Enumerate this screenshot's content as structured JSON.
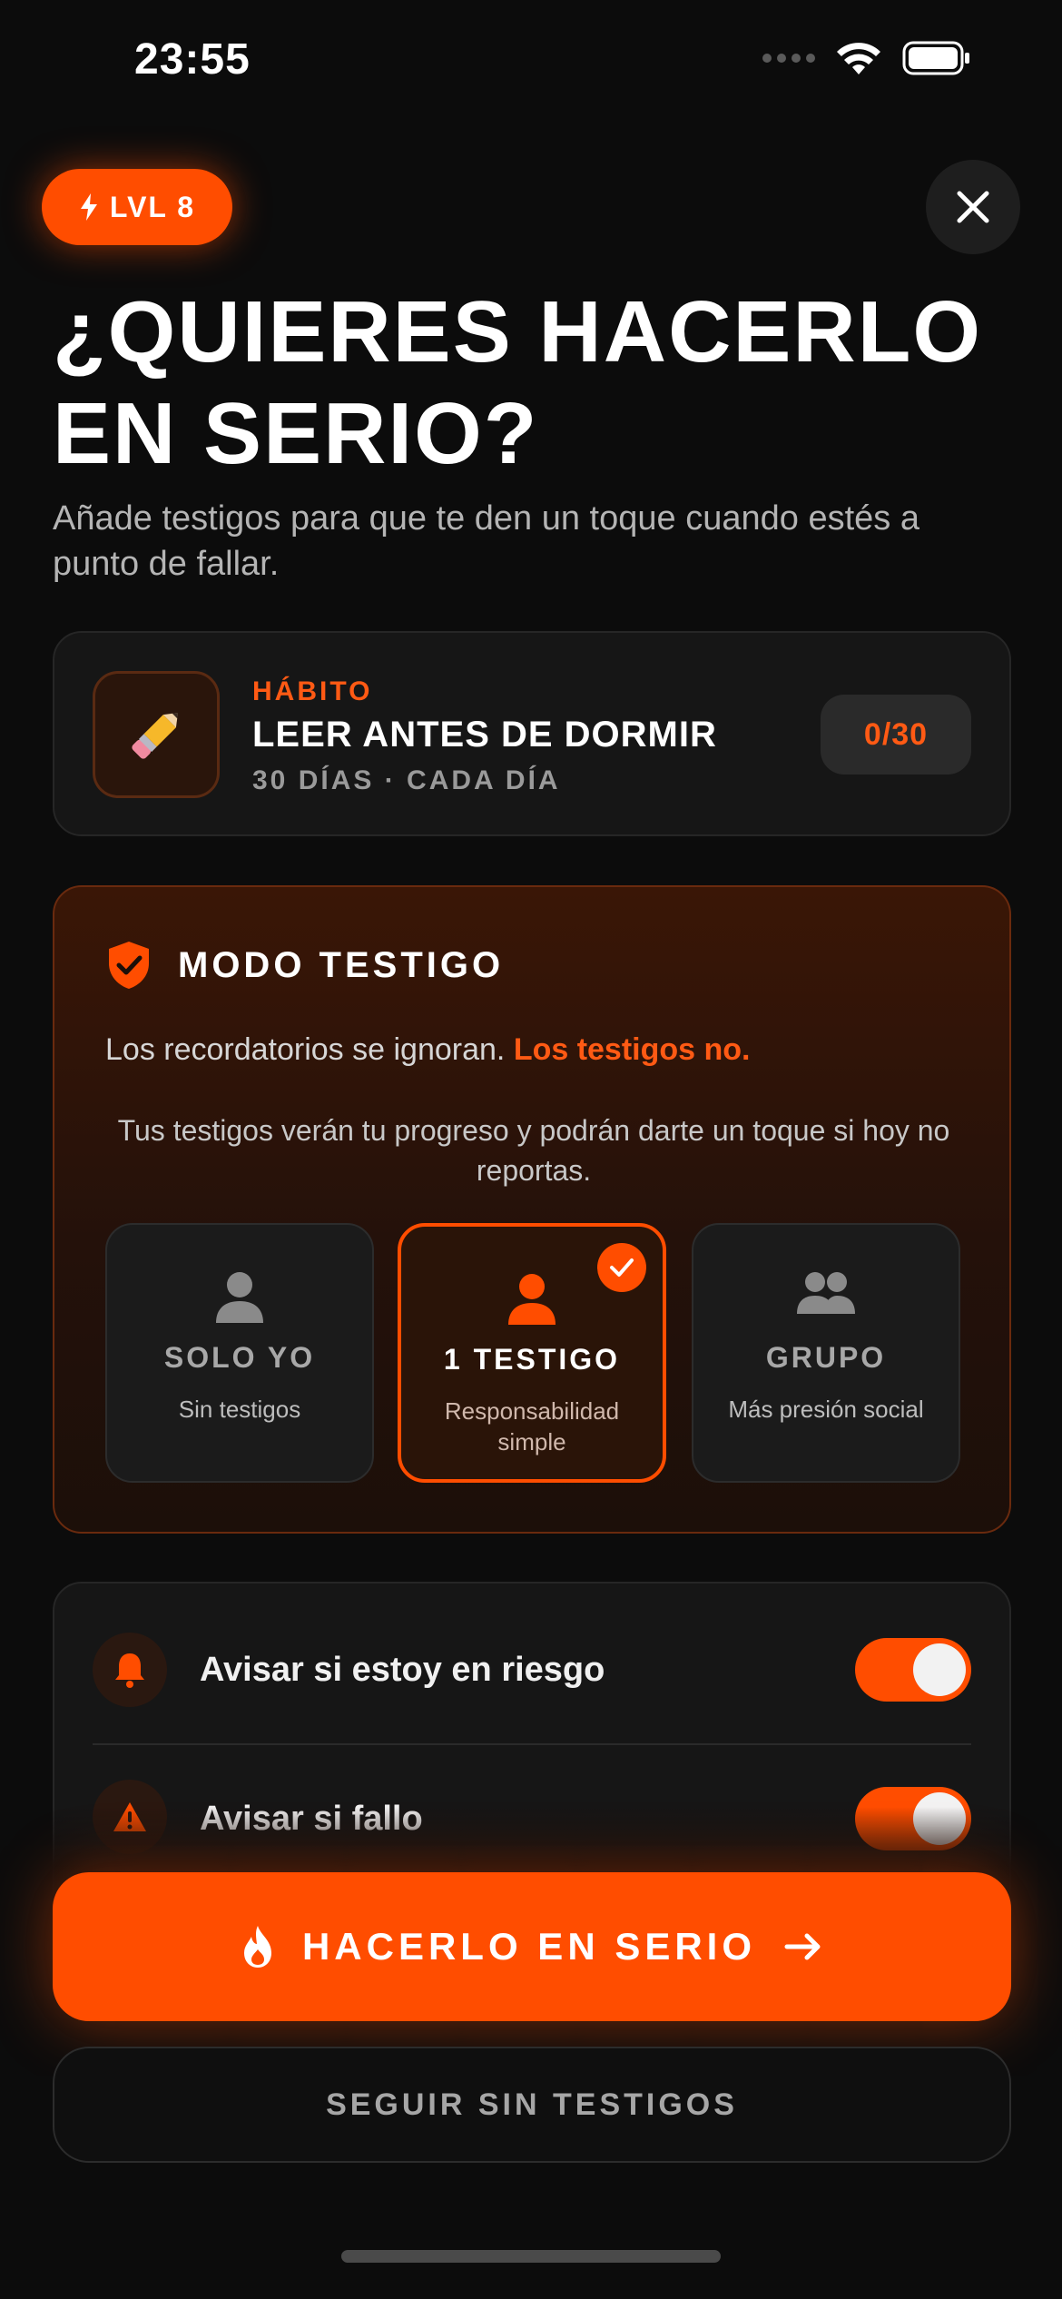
{
  "status_bar": {
    "time": "23:55"
  },
  "header": {
    "level_chip": "LVL 8",
    "title": "¿QUIERES HACERLO EN SERIO?",
    "subtitle": "Añade testigos para que te den un toque cuando estés a punto de fallar."
  },
  "habit": {
    "kicker": "HÁBITO",
    "name": "LEER ANTES DE DORMIR",
    "meta": "30 DÍAS · CADA DÍA",
    "progress": "0/30",
    "icon": "pencil-emoji"
  },
  "witness_mode": {
    "title": "MODO TESTIGO",
    "line1_prefix": "Los recordatorios se ignoran.",
    "line1_highlight": "Los testigos no.",
    "line2": "Tus testigos verán tu progreso y podrán darte un toque si hoy no reportas.",
    "options": [
      {
        "label": "SOLO YO",
        "desc": "Sin testigos",
        "icon": "person-icon",
        "selected": false
      },
      {
        "label": "1 TESTIGO",
        "desc": "Responsabilidad simple",
        "icon": "person-icon",
        "selected": true
      },
      {
        "label": "GRUPO",
        "desc": "Más presión social",
        "icon": "group-icon",
        "selected": false
      }
    ]
  },
  "settings": [
    {
      "label": "Avisar si estoy en riesgo",
      "icon": "bell-icon",
      "enabled": true
    },
    {
      "label": "Avisar si fallo",
      "icon": "warning-icon",
      "enabled": true
    }
  ],
  "actions": {
    "primary": "HACERLO EN SERIO",
    "secondary": "SEGUIR SIN TESTIGOS"
  },
  "colors": {
    "accent": "#ff4d00",
    "background": "#0c0c0c"
  }
}
